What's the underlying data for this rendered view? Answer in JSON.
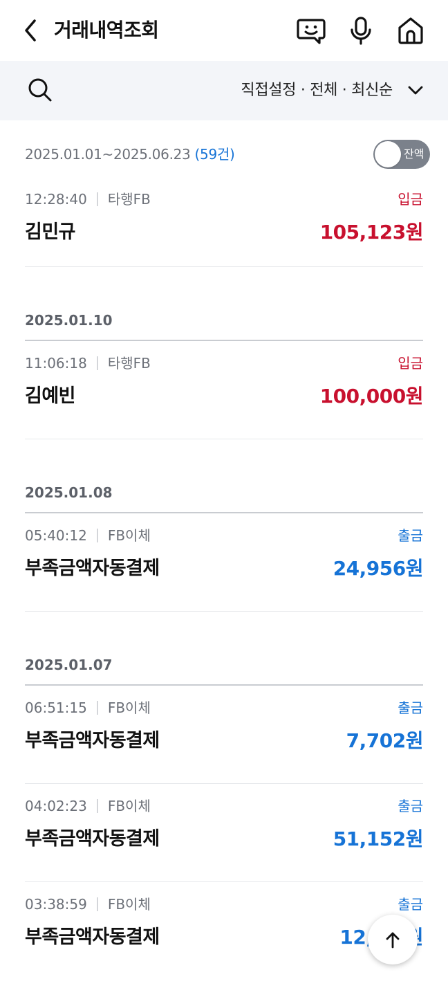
{
  "header": {
    "title": "거래내역조회",
    "icons": [
      "back-arrow-icon",
      "chatbot-icon",
      "microphone-icon",
      "home-icon"
    ]
  },
  "filter": {
    "summary": "직접설정 · 전체 · 최신순",
    "icons": [
      "search-icon",
      "chevron-down-icon"
    ]
  },
  "period": {
    "range": "2025.01.01~2025.06.23",
    "count": "(59건)",
    "balance_toggle_label": "잔액",
    "balance_toggle_on": false
  },
  "colors": {
    "deposit": "#c8102e",
    "withdrawal": "#1673d6",
    "filter_bg": "#f3f5f9"
  },
  "groups": [
    {
      "date": "",
      "items": [
        {
          "time": "12:28:40",
          "channel": "타행FB",
          "name": "김민규",
          "type": "입금",
          "amount": "105,123원",
          "kind": "deposit"
        }
      ]
    },
    {
      "date": "2025.01.10",
      "items": [
        {
          "time": "11:06:18",
          "channel": "타행FB",
          "name": "김예빈",
          "type": "입금",
          "amount": "100,000원",
          "kind": "deposit"
        }
      ]
    },
    {
      "date": "2025.01.08",
      "items": [
        {
          "time": "05:40:12",
          "channel": "FB이체",
          "name": "부족금액자동결제",
          "type": "출금",
          "amount": "24,956원",
          "kind": "withdrawal"
        }
      ]
    },
    {
      "date": "2025.01.07",
      "items": [
        {
          "time": "06:51:15",
          "channel": "FB이체",
          "name": "부족금액자동결제",
          "type": "출금",
          "amount": "7,702원",
          "kind": "withdrawal"
        },
        {
          "time": "04:02:23",
          "channel": "FB이체",
          "name": "부족금액자동결제",
          "type": "출금",
          "amount": "51,152원",
          "kind": "withdrawal"
        },
        {
          "time": "03:38:59",
          "channel": "FB이체",
          "name": "부족금액자동결제",
          "type": "출금",
          "amount": "12,???원",
          "kind": "withdrawal"
        }
      ]
    }
  ],
  "scroll_top_icon": "arrow-up-icon"
}
